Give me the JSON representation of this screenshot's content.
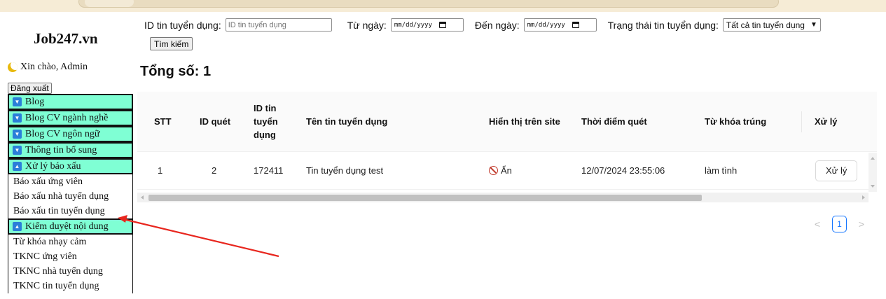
{
  "brand": "Job247.vn",
  "greeting": "Xin chào, Admin",
  "logout_label": "Đăng xuất",
  "menu": {
    "groups": [
      {
        "label": "Blog",
        "toggle": "▼",
        "items": []
      },
      {
        "label": "Blog CV ngành nghề",
        "toggle": "▼",
        "items": []
      },
      {
        "label": "Blog CV ngôn ngữ",
        "toggle": "▼",
        "items": []
      },
      {
        "label": "Thông tin bổ sung",
        "toggle": "▼",
        "items": []
      },
      {
        "label": "Xử lý báo xấu",
        "toggle": "▲",
        "items": [
          "Báo xấu ứng viên",
          "Báo xấu nhà tuyển dụng",
          "Báo xấu tin tuyển dụng"
        ]
      },
      {
        "label": "Kiểm duyệt nội dung",
        "toggle": "▲",
        "items": [
          "Từ khóa nhạy cảm",
          "TKNC ứng viên",
          "TKNC nhà tuyển dụng",
          "TKNC tin tuyển dụng"
        ]
      }
    ]
  },
  "filters": {
    "id_label": "ID tin tuyển dụng:",
    "id_placeholder": "ID tin tuyển dụng",
    "from_label": "Từ ngày:",
    "from_value": "mm/dd/yyyy",
    "to_label": "Đến ngày:",
    "to_value": "mm/dd/yyyy",
    "status_label": "Trạng thái tin tuyển dụng:",
    "status_value": "Tất cả tin tuyển dụng",
    "search_button": "Tìm kiếm"
  },
  "total_label": "Tổng số: 1",
  "table": {
    "headers": {
      "stt": "STT",
      "id_quet": "ID quét",
      "id_tin": [
        "ID tin",
        "tuyển",
        "dụng"
      ],
      "ten_tin": "Tên tin tuyển dụng",
      "hien_thi": "Hiển thị trên site",
      "thoi_diem": "Thời điểm quét",
      "tu_khoa": "Từ khóa trúng",
      "xu_ly": "Xử lý"
    },
    "rows": [
      {
        "stt": "1",
        "id_quet": "2",
        "id_tin": "172411",
        "ten_tin": "Tin tuyển dụng test",
        "hien_thi": "Ẩn",
        "thoi_diem": "12/07/2024 23:55:06",
        "tu_khoa": "làm tình",
        "action": "Xử lý"
      }
    ]
  },
  "pagination": {
    "prev": "<",
    "current": "1",
    "next": ">"
  },
  "colors": {
    "menu_bg": "#7fffd4",
    "toggle_icon": "#2b7fd9",
    "annotation_arrow": "#e8261e",
    "page_active": "#1677ff"
  }
}
